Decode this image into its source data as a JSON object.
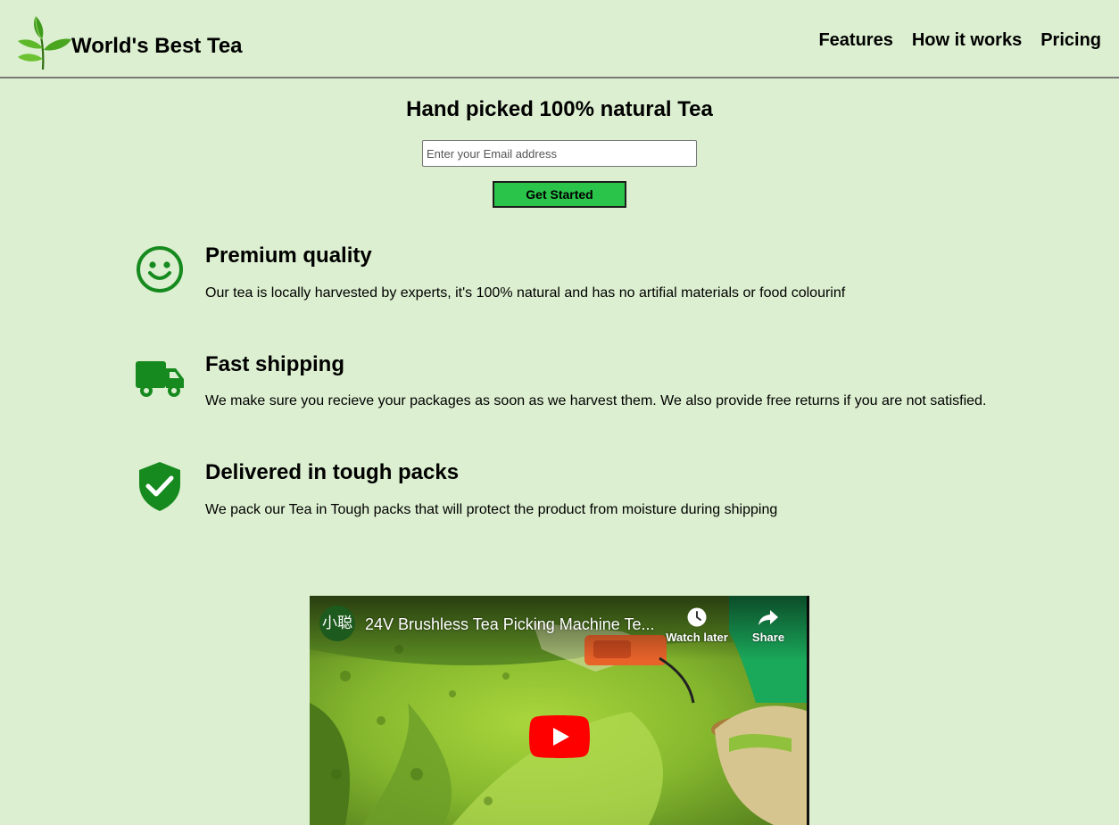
{
  "header": {
    "brand": "World's Best Tea",
    "nav": [
      "Features",
      "How it works",
      "Pricing"
    ]
  },
  "hero": {
    "title": "Hand picked 100% natural Tea",
    "email_placeholder": "Enter your Email address",
    "cta_label": "Get Started"
  },
  "features": [
    {
      "icon": "smile-icon",
      "title": "Premium quality",
      "text": "Our tea is locally harvested by experts, it's 100% natural and has no artifial materials or food colourinf"
    },
    {
      "icon": "truck-icon",
      "title": "Fast shipping",
      "text": "We make sure you recieve your packages as soon as we harvest them. We also provide free returns if you are not satisfied."
    },
    {
      "icon": "shield-check-icon",
      "title": "Delivered in tough packs",
      "text": "We pack our Tea in Tough packs that will protect the product from moisture during shipping"
    }
  ],
  "video": {
    "channel_avatar": "小聪",
    "title": "24V Brushless Tea Picking Machine Te...",
    "watch_later": "Watch later",
    "share": "Share"
  },
  "colors": {
    "page_bg": "#dcefd0",
    "button_green": "#2bc44a",
    "icon_green": "#168a1e",
    "youtube_red": "#ff0000"
  }
}
